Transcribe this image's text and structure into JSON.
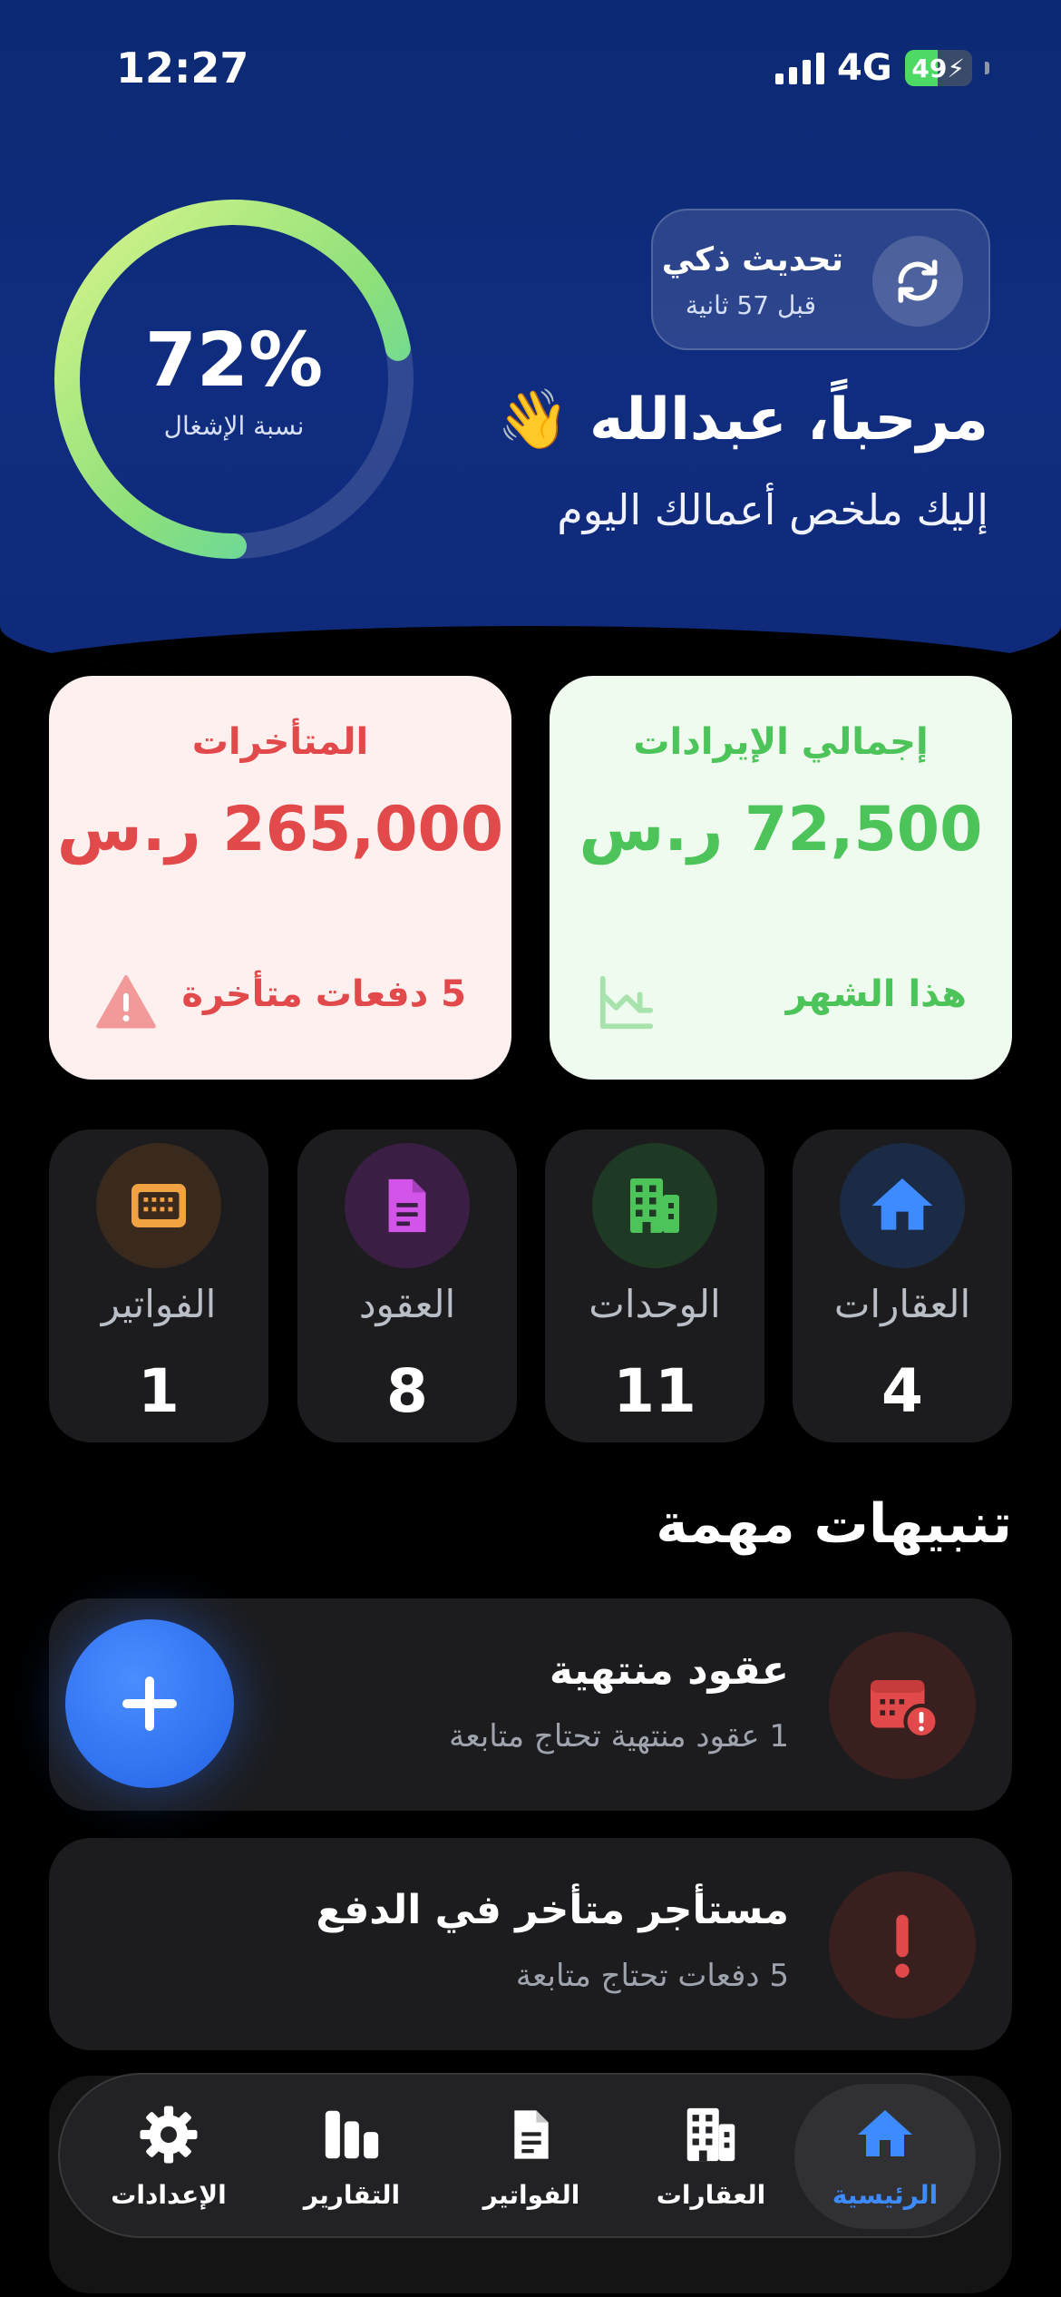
{
  "status_bar": {
    "time": "12:27",
    "network": "4G",
    "battery": "49"
  },
  "occupancy": {
    "value": "72%",
    "label": "نسبة الإشغال",
    "fraction": 0.72
  },
  "smart_refresh": {
    "title": "تحديث ذكي",
    "subtitle": "قبل 57 ثانية"
  },
  "greeting": {
    "title": "مرحباً، عبدالله 👋",
    "subtitle": "إليك ملخص أعمالك اليوم"
  },
  "cards": {
    "revenue": {
      "title": "إجمالي الإيرادات",
      "amount": "72,500 ر.س",
      "footer": "هذا الشهر"
    },
    "overdue": {
      "title": "المتأخرات",
      "amount": "265,000 ر.س",
      "footer": "5 دفعات متأخرة"
    }
  },
  "stats": [
    {
      "label": "العقارات",
      "value": "4"
    },
    {
      "label": "الوحدات",
      "value": "11"
    },
    {
      "label": "العقود",
      "value": "8"
    },
    {
      "label": "الفواتير",
      "value": "1"
    }
  ],
  "alerts_section": {
    "title": "تنبيهات مهمة"
  },
  "alerts": [
    {
      "title": "عقود منتهية",
      "subtitle": "1 عقود منتهية تحتاج متابعة"
    },
    {
      "title": "مستأجر متأخر في الدفع",
      "subtitle": "5 دفعات تحتاج متابعة"
    }
  ],
  "tabbar": [
    {
      "label": "الرئيسية"
    },
    {
      "label": "العقارات"
    },
    {
      "label": "الفواتير"
    },
    {
      "label": "التقارير"
    },
    {
      "label": "الإعدادات"
    }
  ],
  "colors": {
    "header": "#102c80",
    "revenue": "#4cc45a",
    "overdue": "#e2494a",
    "active_tab": "#3d8bff",
    "fab": "#2f6fef"
  }
}
